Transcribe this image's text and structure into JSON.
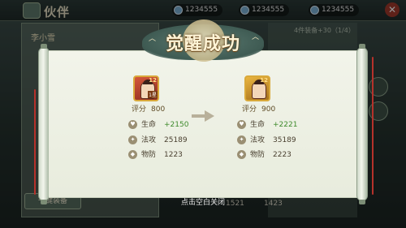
{
  "header": {
    "title": "伙伴",
    "resources": [
      {
        "icon": "crystal-icon",
        "value": "1234555"
      },
      {
        "icon": "crystal-icon",
        "value": "1234555"
      },
      {
        "icon": "crystal-icon",
        "value": "1234555"
      }
    ]
  },
  "background": {
    "user_name": "李小雪",
    "right_info": "4件装备+30（1/4）",
    "bottom_button": "一键装备",
    "bottom_values": [
      "1521",
      "1423"
    ]
  },
  "dialog": {
    "title": "觉醒成功",
    "before": {
      "level_badge": "12",
      "star_tag": "1星",
      "rating_label": "评分",
      "rating_value": "800",
      "stats": [
        {
          "icon": "heart-icon",
          "label": "生命",
          "value": "+2150",
          "highlight": true
        },
        {
          "icon": "magic-icon",
          "label": "法攻",
          "value": "25189",
          "highlight": false
        },
        {
          "icon": "shield-icon",
          "label": "物防",
          "value": "1223",
          "highlight": false
        }
      ]
    },
    "after": {
      "level_badge": "12",
      "rating_label": "评分",
      "rating_value": "900",
      "stats": [
        {
          "icon": "heart-icon",
          "label": "生命",
          "value": "+2221",
          "highlight": true
        },
        {
          "icon": "magic-icon",
          "label": "法攻",
          "value": "35189",
          "highlight": false
        },
        {
          "icon": "shield-icon",
          "label": "物防",
          "value": "2223",
          "highlight": false
        }
      ]
    },
    "footer_tip": "点击空白关闭"
  },
  "colors": {
    "highlight_green": "#3e8a2c",
    "scroll_paper": "#f2f4ea",
    "title_gold": "#fff4d6"
  }
}
